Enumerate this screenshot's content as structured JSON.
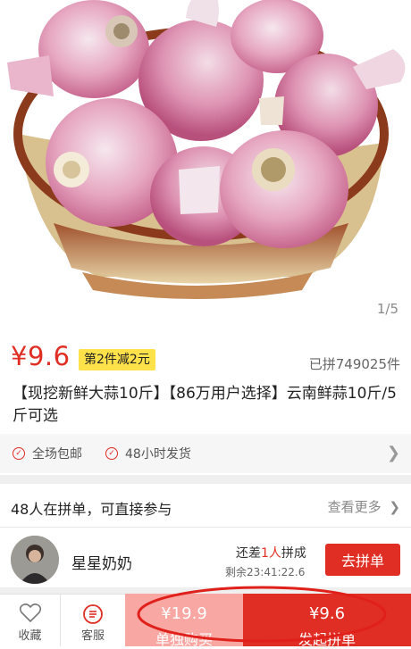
{
  "gallery": {
    "counter": "1/5",
    "image_alt": "garlic-in-basket"
  },
  "product": {
    "price": "¥9.6",
    "promo_tag": "第2件减2元",
    "sold_count": "已拼749025件",
    "title": "【现挖新鲜大蒜10斤】【86万用户选择】云南鲜蒜10斤/5斤可选"
  },
  "services": {
    "items": [
      "全场包邮",
      "48小时发货"
    ]
  },
  "group_buy": {
    "header": "48人在拼单，可直接参与",
    "more": "查看更多",
    "entry": {
      "user": "星星奶奶",
      "need_prefix": "还差",
      "need_count": "1人",
      "need_suffix": "拼成",
      "remaining": "剩余23:41:22.6",
      "join_label": "去拼单"
    }
  },
  "bottom_bar": {
    "favorite": "收藏",
    "service": "客服",
    "solo_price": "¥19.9",
    "solo_label": "单独购买",
    "group_price": "¥9.6",
    "group_label": "发起拼单"
  },
  "colors": {
    "accent": "#e02e24",
    "solo_bg": "#f9a7a3",
    "promo_bg": "#ffe24a"
  }
}
